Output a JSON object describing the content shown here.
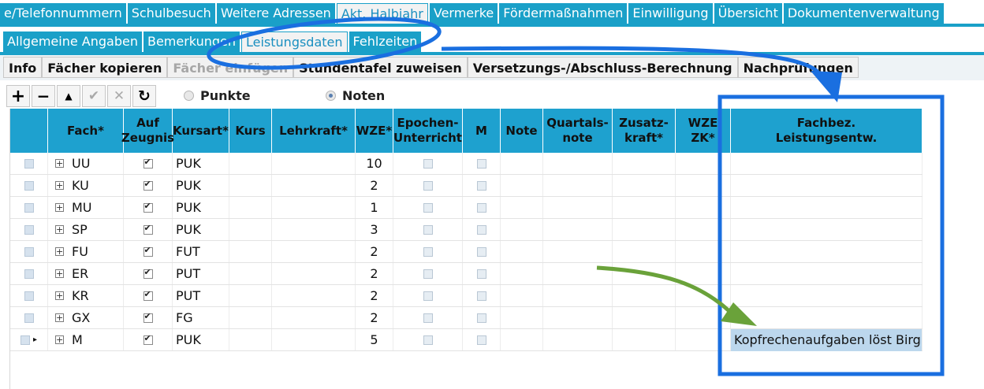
{
  "tabs_main": [
    "e/Telefonnummern",
    "Schulbesuch",
    "Weitere Adressen",
    "Akt. Halbjahr",
    "Vermerke",
    "Fördermaßnahmen",
    "Einwilligung",
    "Übersicht",
    "Dokumentenverwaltung"
  ],
  "tabs_sub": [
    "Allgemeine Angaben",
    "Bemerkungen",
    "Leistungsdaten",
    "Fehlzeiten"
  ],
  "actions": [
    "Info",
    "Fächer kopieren",
    "Fächer einfügen",
    "Stundentafel zuweisen",
    "Versetzungs-/Abschluss-Berechnung",
    "Nachprüfungen"
  ],
  "toolbar": {
    "add": "+",
    "remove": "−",
    "up": "▲",
    "confirm": "✔",
    "cancel": "✕",
    "refresh": "↻"
  },
  "radio": {
    "punkte": "Punkte",
    "noten": "Noten",
    "selected": "Noten"
  },
  "columns": [
    "",
    "Fach*",
    "Auf Zeugnis",
    "Kursart*",
    "Kurs",
    "Lehrkraft*",
    "WZE*",
    "Epochen-Unterricht",
    "M",
    "Note",
    "Quartals-note",
    "Zusatz-kraft*",
    "WZE ZK*",
    "Fachbez. Leistungsentw."
  ],
  "col_lines": {
    "auf": [
      "Auf",
      "Zeugnis"
    ],
    "epochen": [
      "Epochen-",
      "Unterricht"
    ],
    "quartals": [
      "Quartals-",
      "note"
    ],
    "zusatz": [
      "Zusatz-",
      "kraft*"
    ],
    "wzezk": [
      "WZE",
      "ZK*"
    ],
    "fachbez": [
      "Fachbez.",
      "Leistungsentw."
    ]
  },
  "rows": [
    {
      "fach": "UU",
      "zeugnis": true,
      "kursart": "PUK",
      "wze": "10",
      "epochen": false,
      "m": false,
      "fachbez": ""
    },
    {
      "fach": "KU",
      "zeugnis": true,
      "kursart": "PUK",
      "wze": "2",
      "epochen": false,
      "m": false,
      "fachbez": ""
    },
    {
      "fach": "MU",
      "zeugnis": true,
      "kursart": "PUK",
      "wze": "1",
      "epochen": false,
      "m": false,
      "fachbez": ""
    },
    {
      "fach": "SP",
      "zeugnis": true,
      "kursart": "PUK",
      "wze": "3",
      "epochen": false,
      "m": false,
      "fachbez": ""
    },
    {
      "fach": "FU",
      "zeugnis": true,
      "kursart": "FUT",
      "wze": "2",
      "epochen": false,
      "m": false,
      "fachbez": ""
    },
    {
      "fach": "ER",
      "zeugnis": true,
      "kursart": "PUT",
      "wze": "2",
      "epochen": false,
      "m": false,
      "fachbez": ""
    },
    {
      "fach": "KR",
      "zeugnis": true,
      "kursart": "PUT",
      "wze": "2",
      "epochen": false,
      "m": false,
      "fachbez": ""
    },
    {
      "fach": "GX",
      "zeugnis": true,
      "kursart": "FG",
      "wze": "2",
      "epochen": false,
      "m": false,
      "fachbez": ""
    },
    {
      "fach": "M",
      "zeugnis": true,
      "kursart": "PUK",
      "wze": "5",
      "epochen": false,
      "m": false,
      "fachbez": "Kopfrechenaufgaben löst Birg..."
    }
  ],
  "colors": {
    "accent": "#1aa0c8",
    "header": "#1ea1cf",
    "annotation_blue": "#1a6fe0",
    "annotation_green": "#6aa23a"
  }
}
